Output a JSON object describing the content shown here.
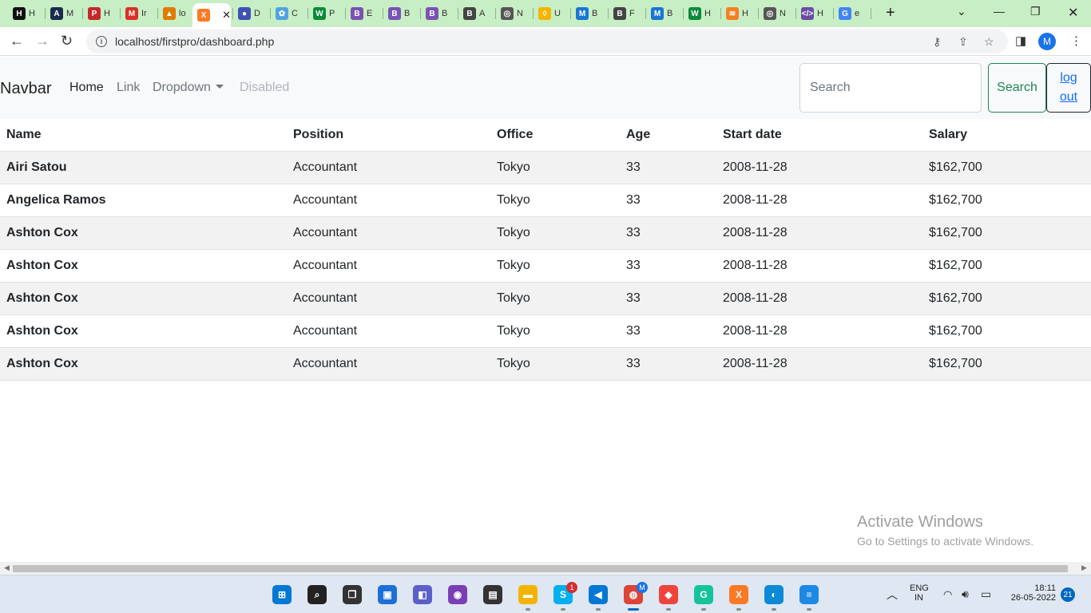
{
  "browser": {
    "tabs": [
      {
        "favicon": "H",
        "label": "H",
        "color": "#111111"
      },
      {
        "favicon": "A",
        "label": "M",
        "color": "#1a2b4c"
      },
      {
        "favicon": "P",
        "label": "H",
        "color": "#c62828"
      },
      {
        "favicon": "M",
        "label": "Ir",
        "color": "#d93025"
      },
      {
        "favicon": "▲",
        "label": "lo",
        "color": "#e07b00"
      },
      {
        "favicon": "X",
        "label": "",
        "color": "#fb7a24",
        "active": true
      },
      {
        "favicon": "●",
        "label": "D",
        "color": "#3f51b5"
      },
      {
        "favicon": "✿",
        "label": "C",
        "color": "#4fa3e0"
      },
      {
        "favicon": "W",
        "label": "P",
        "color": "#0a8a3a"
      },
      {
        "favicon": "B",
        "label": "E",
        "color": "#7952b3"
      },
      {
        "favicon": "B",
        "label": "B",
        "color": "#7952b3"
      },
      {
        "favicon": "B",
        "label": "B",
        "color": "#7952b3"
      },
      {
        "favicon": "B",
        "label": "A",
        "color": "#444444"
      },
      {
        "favicon": "◎",
        "label": "N",
        "color": "#555555"
      },
      {
        "favicon": "◊",
        "label": "U",
        "color": "#f4b400"
      },
      {
        "favicon": "M",
        "label": "B",
        "color": "#1976d2"
      },
      {
        "favicon": "B",
        "label": "F",
        "color": "#444444"
      },
      {
        "favicon": "M",
        "label": "B",
        "color": "#1976d2"
      },
      {
        "favicon": "W",
        "label": "H",
        "color": "#0a8a3a"
      },
      {
        "favicon": "≋",
        "label": "H",
        "color": "#f48024"
      },
      {
        "favicon": "◎",
        "label": "N",
        "color": "#555555"
      },
      {
        "favicon": "</>",
        "label": "H",
        "color": "#6a4ca3"
      },
      {
        "favicon": "G",
        "label": "e",
        "color": "#4285f4"
      }
    ],
    "url": "localhost/firstpro/dashboard.php",
    "profile_initial": "M"
  },
  "navbar": {
    "brand": "Navbar",
    "links": [
      {
        "label": "Home",
        "state": "active"
      },
      {
        "label": "Link",
        "state": "normal"
      },
      {
        "label": "Dropdown",
        "state": "dropdown"
      },
      {
        "label": "Disabled",
        "state": "disabled"
      }
    ],
    "search_placeholder": "Search",
    "search_button": "Search",
    "logout_label": "log out"
  },
  "table": {
    "headers": [
      "Name",
      "Position",
      "Office",
      "Age",
      "Start date",
      "Salary"
    ],
    "rows": [
      [
        "Airi Satou",
        "Accountant",
        "Tokyo",
        "33",
        "2008-11-28",
        "$162,700"
      ],
      [
        "Angelica Ramos",
        "Accountant",
        "Tokyo",
        "33",
        "2008-11-28",
        "$162,700"
      ],
      [
        "Ashton Cox",
        "Accountant",
        "Tokyo",
        "33",
        "2008-11-28",
        "$162,700"
      ],
      [
        "Ashton Cox",
        "Accountant",
        "Tokyo",
        "33",
        "2008-11-28",
        "$162,700"
      ],
      [
        "Ashton Cox",
        "Accountant",
        "Tokyo",
        "33",
        "2008-11-28",
        "$162,700"
      ],
      [
        "Ashton Cox",
        "Accountant",
        "Tokyo",
        "33",
        "2008-11-28",
        "$162,700"
      ],
      [
        "Ashton Cox",
        "Accountant",
        "Tokyo",
        "33",
        "2008-11-28",
        "$162,700"
      ]
    ]
  },
  "watermark": {
    "title": "Activate Windows",
    "subtitle": "Go to Settings to activate Windows."
  },
  "taskbar": {
    "icons": [
      {
        "name": "windows-start-icon",
        "glyph": "⊞",
        "color": "#0078d4"
      },
      {
        "name": "search-icon",
        "glyph": "⌕",
        "color": "#222222"
      },
      {
        "name": "task-view-icon",
        "glyph": "❐",
        "color": "#333333"
      },
      {
        "name": "widgets-icon",
        "glyph": "▣",
        "color": "#1e6fd6"
      },
      {
        "name": "teams-chat-icon",
        "glyph": "◧",
        "color": "#5b5fc7"
      },
      {
        "name": "github-desktop-icon",
        "glyph": "◉",
        "color": "#7b3fb5"
      },
      {
        "name": "store-icon",
        "glyph": "▤",
        "color": "#333333"
      },
      {
        "name": "file-explorer-icon",
        "glyph": "▬",
        "color": "#f2b400"
      },
      {
        "name": "skype-icon",
        "glyph": "S",
        "color": "#00aff0",
        "badge": "1"
      },
      {
        "name": "vscode-icon",
        "glyph": "◀",
        "color": "#0078d4"
      },
      {
        "name": "chrome-icon",
        "glyph": "◍",
        "color": "#db4437",
        "badge": "M"
      },
      {
        "name": "anydesk-icon",
        "glyph": "◆",
        "color": "#ef443b"
      },
      {
        "name": "grammarly-icon",
        "glyph": "G",
        "color": "#15c39a"
      },
      {
        "name": "xampp-icon",
        "glyph": "X",
        "color": "#fb7a24"
      },
      {
        "name": "edge-icon",
        "glyph": "◐",
        "color": "#0c8ad6"
      },
      {
        "name": "notepad-icon",
        "glyph": "≡",
        "color": "#1e88e5"
      }
    ],
    "language_line1": "ENG",
    "language_line2": "IN",
    "time": "18:11",
    "date": "26-05-2022",
    "notification_count": "21"
  }
}
